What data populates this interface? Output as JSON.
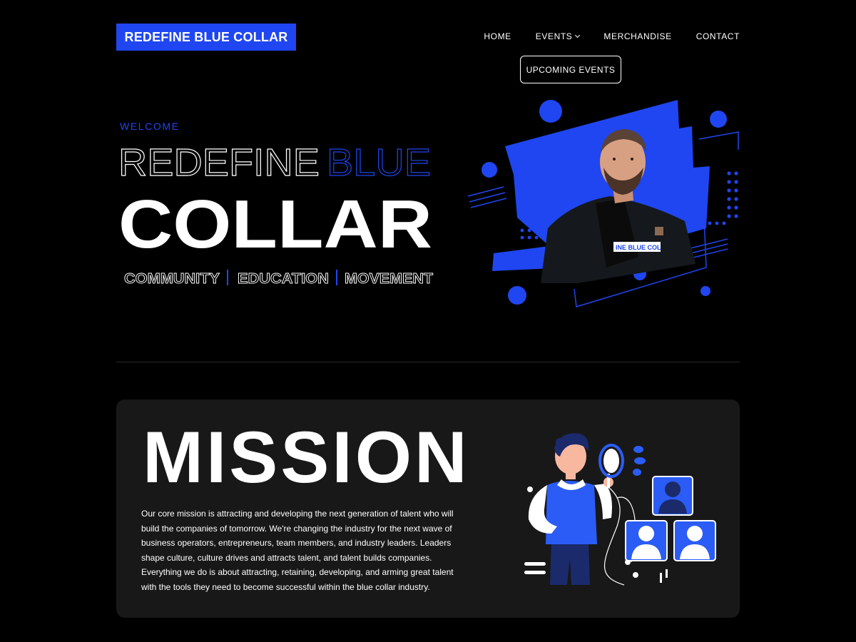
{
  "brand": {
    "logo_text": "REDEFINE BLUE COLLAR"
  },
  "nav": {
    "items": [
      "HOME",
      "EVENTS",
      "MERCHANDISE",
      "CONTACT"
    ],
    "dropdown_item": "UPCOMING EVENTS"
  },
  "hero": {
    "welcome": "WELCOME",
    "line1_word1": "REDEFINE",
    "line1_word2": "BLUE",
    "line2": "COLLAR",
    "taglines": [
      "COMMUNITY",
      "EDUCATION",
      "MOVEMENT"
    ],
    "shirt_text": "INE BLUE COL"
  },
  "mission": {
    "title": "MISSION",
    "text": "Our core mission is attracting and developing the next generation of talent who will build the companies of tomorrow. We're changing the industry for the next wave of business operators, entrepreneurs, team members, and industry leaders. Leaders shape culture, culture drives and attracts talent, and talent builds companies. Everything we do is about attracting, retaining, developing, and arming great talent with the tools they need to become successful within the blue collar industry."
  },
  "colors": {
    "accent": "#1f46f0",
    "background": "#000000",
    "card": "#181818"
  },
  "icons": [
    "chevron-down-icon",
    "user-avatar-icon",
    "magnifier-icon"
  ]
}
